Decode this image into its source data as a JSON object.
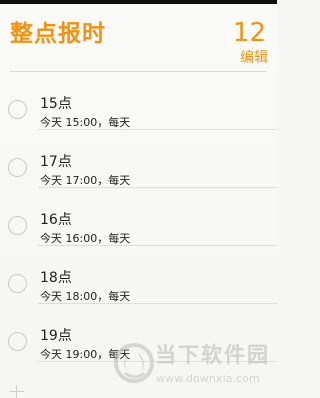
{
  "colors": {
    "accent": "#F4920F",
    "text": "#1F1F1F",
    "separator": "#DEDEDE",
    "background": "#F7F7F5"
  },
  "header": {
    "title": "整点报时",
    "count": "12",
    "edit_label": "编辑"
  },
  "reminders": [
    {
      "title": "15点",
      "alarm": "今天 15:00，每天"
    },
    {
      "title": "17点",
      "alarm": "今天 17:00，每天"
    },
    {
      "title": "16点",
      "alarm": "今天 16:00，每天"
    },
    {
      "title": "18点",
      "alarm": "今天 18:00，每天"
    },
    {
      "title": "19点",
      "alarm": "今天 19:00，每天"
    }
  ],
  "footer": {
    "add_icon": "plus-icon"
  },
  "watermark": {
    "name": "当下软件园",
    "domain": "www.downxia.com"
  }
}
